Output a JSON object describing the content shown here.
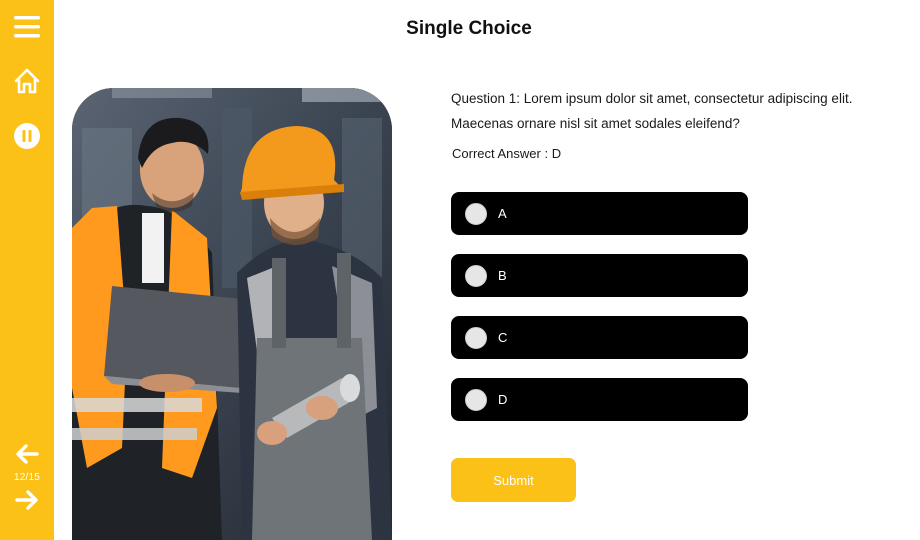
{
  "colors": {
    "accent": "#FCC116",
    "option_bg": "#000000",
    "text": "#111111"
  },
  "sidebar": {
    "icons": [
      "menu-icon",
      "home-icon",
      "pause-icon",
      "arrow-left-icon",
      "arrow-right-icon"
    ],
    "page_counter": "12/15"
  },
  "header": {
    "title": "Single Choice"
  },
  "question": {
    "text": "Question 1: Lorem ipsum dolor sit amet, consectetur adipiscing elit. Maecenas ornare nisl sit amet sodales eleifend?",
    "correct_answer": "Correct Answer : D"
  },
  "options": [
    {
      "label": "A"
    },
    {
      "label": "B"
    },
    {
      "label": "C"
    },
    {
      "label": "D"
    }
  ],
  "submit_label": "Submit"
}
